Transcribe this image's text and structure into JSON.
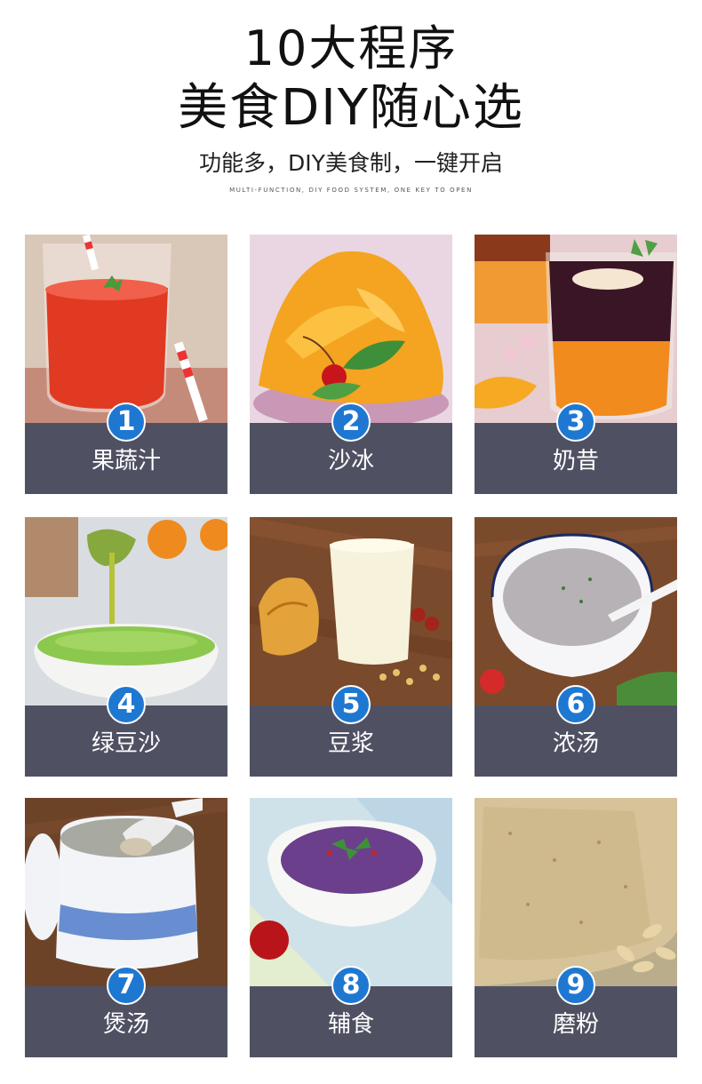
{
  "header": {
    "title_line1": "10大程序",
    "title_line2": "美食DIY随心选",
    "subtitle": "功能多，DIY美食制，一键开启",
    "subtitle_en": "MULTI-FUNCTION, DIY FOOD SYSTEM, ONE KEY TO OPEN"
  },
  "programs": [
    {
      "number": "1",
      "label": "果蔬汁"
    },
    {
      "number": "2",
      "label": "沙冰"
    },
    {
      "number": "3",
      "label": "奶昔"
    },
    {
      "number": "4",
      "label": "绿豆沙"
    },
    {
      "number": "5",
      "label": "豆浆"
    },
    {
      "number": "6",
      "label": "浓汤"
    },
    {
      "number": "7",
      "label": "煲汤"
    },
    {
      "number": "8",
      "label": "辅食"
    },
    {
      "number": "9",
      "label": "磨粉"
    }
  ],
  "colors": {
    "label_bar": "#4f5163",
    "badge": "#1e78d2"
  }
}
